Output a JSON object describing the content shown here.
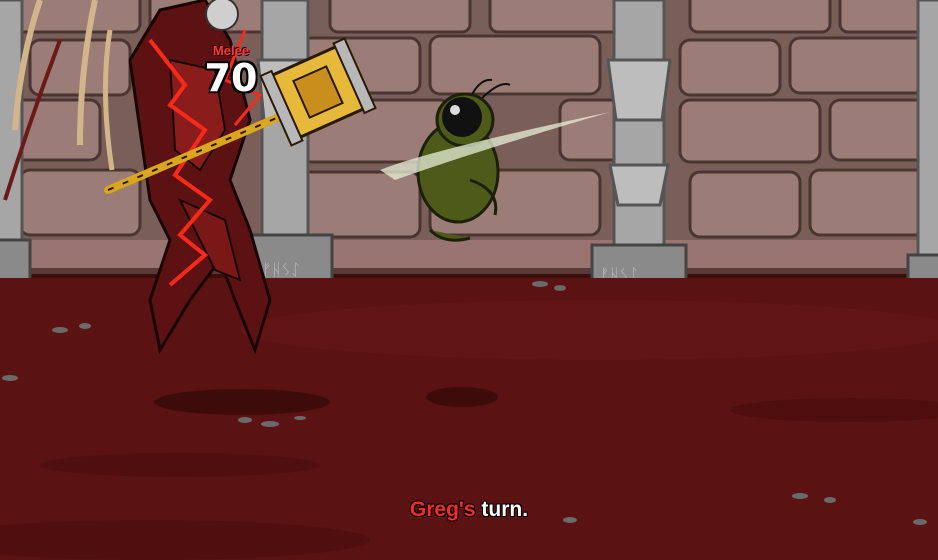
{
  "battle": {
    "damage_popup": {
      "type_label": "Melee",
      "value": "70"
    },
    "turn_indicator": {
      "player_name": "Greg's",
      "suffix": " turn."
    }
  },
  "colors": {
    "floor": "#5a1212",
    "wall": "#8a6a66",
    "pillar": "#a9a9a9",
    "enemy_glow": "#ff2a1a",
    "turn_name": "#ff2a2a"
  }
}
